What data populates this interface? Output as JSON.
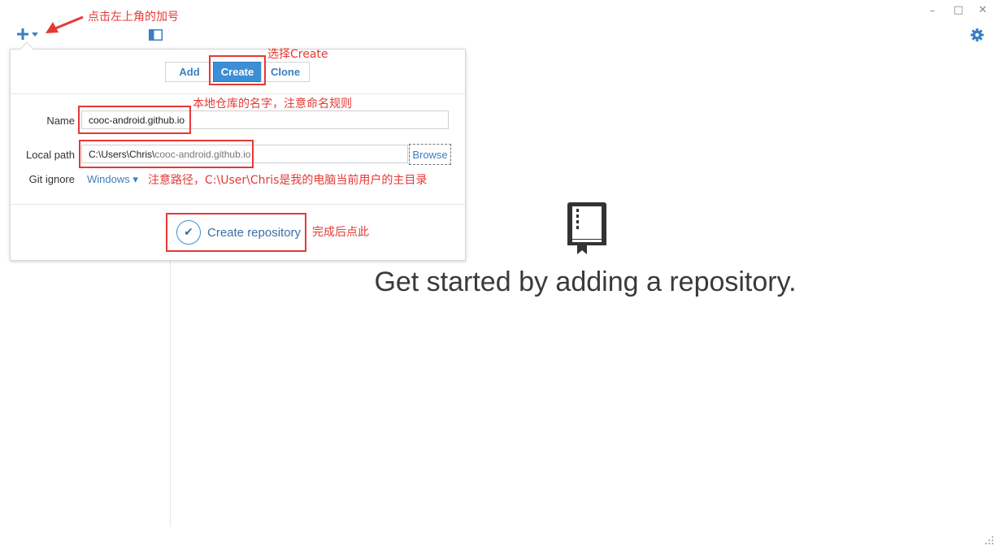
{
  "toolbar": {
    "add_icon": "plus-icon",
    "add_dropdown_icon": "caret-down-icon",
    "sidebar_toggle_icon": "panel-toggle-icon"
  },
  "window_controls": {
    "minimize": "–",
    "maximize": "□",
    "close": "✕",
    "settings_icon": "gear-icon"
  },
  "popup": {
    "tabs": [
      {
        "label": "Add",
        "active": false
      },
      {
        "label": "Create",
        "active": true
      },
      {
        "label": "Clone",
        "active": false
      }
    ],
    "name_label": "Name",
    "name_value": "cooc-android.github.io",
    "local_path_label": "Local path",
    "local_path_prefix": "C:\\Users\\Chris\\",
    "local_path_repo": "cooc-android.github.io",
    "browse_label": "Browse",
    "git_ignore_label": "Git ignore",
    "git_ignore_value": "Windows ▾",
    "create_button_label": "Create repository"
  },
  "annotations": {
    "top_left": "点击左上角的加号",
    "create": "选择Create",
    "name": "本地仓库的名字，注意命名规则",
    "path": "注意路径，C:\\User\\Chris是我的电脑当前用户的主目录",
    "done": "完成后点此"
  },
  "empty_state": {
    "icon": "book-icon",
    "title": "Get started by adding a repository."
  },
  "colors": {
    "accent": "#3b8fd6",
    "annotation_red": "#e53935"
  }
}
